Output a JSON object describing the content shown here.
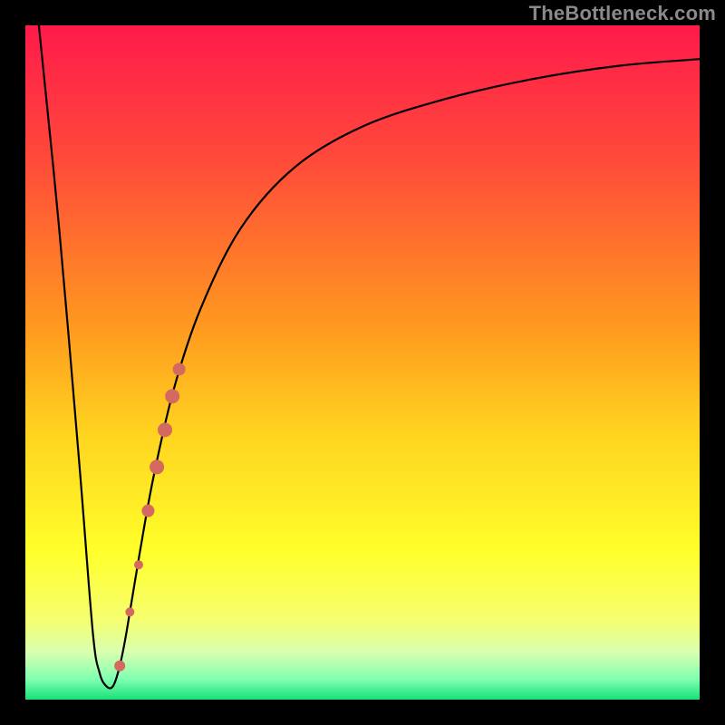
{
  "watermark": {
    "text": "TheBottleneck.com"
  },
  "chart_data": {
    "type": "line",
    "title": "",
    "xlabel": "",
    "ylabel": "",
    "xlim": [
      0,
      100
    ],
    "ylim": [
      0,
      100
    ],
    "grid": false,
    "legend": false,
    "background_gradient_stops": [
      {
        "pct": 0,
        "color": "#ff1a4b"
      },
      {
        "pct": 20,
        "color": "#ff4a3a"
      },
      {
        "pct": 45,
        "color": "#ff9a1f"
      },
      {
        "pct": 60,
        "color": "#ffd21f"
      },
      {
        "pct": 78,
        "color": "#ffff2a"
      },
      {
        "pct": 88,
        "color": "#f6ff6e"
      },
      {
        "pct": 93,
        "color": "#d9ffb0"
      },
      {
        "pct": 97,
        "color": "#7fffb0"
      },
      {
        "pct": 100,
        "color": "#18e078"
      }
    ],
    "series": [
      {
        "name": "bottleneck-curve",
        "stroke": "#000000",
        "stroke_width": 2.2,
        "x": [
          2,
          5,
          8,
          10,
          11,
          12,
          13,
          14,
          15,
          17,
          19,
          22,
          26,
          32,
          40,
          50,
          62,
          75,
          88,
          100
        ],
        "y": [
          100,
          70,
          35,
          10,
          4,
          2,
          2,
          5,
          10,
          22,
          33,
          46,
          58,
          70,
          79,
          85,
          89,
          92,
          94,
          95
        ]
      }
    ],
    "markers": [
      {
        "name": "marker-dot",
        "x": 14.0,
        "y": 5.0,
        "r": 6,
        "color": "#d46a5f"
      },
      {
        "name": "marker-dot",
        "x": 15.5,
        "y": 13.0,
        "r": 5,
        "color": "#d46a5f"
      },
      {
        "name": "marker-dot",
        "x": 16.8,
        "y": 20.0,
        "r": 5,
        "color": "#d46a5f"
      },
      {
        "name": "marker-dot",
        "x": 18.2,
        "y": 28.0,
        "r": 7,
        "color": "#d46a5f"
      },
      {
        "name": "marker-dot",
        "x": 19.5,
        "y": 34.5,
        "r": 8,
        "color": "#d46a5f"
      },
      {
        "name": "marker-dot",
        "x": 20.7,
        "y": 40.0,
        "r": 8,
        "color": "#d46a5f"
      },
      {
        "name": "marker-dot",
        "x": 21.8,
        "y": 45.0,
        "r": 8,
        "color": "#d46a5f"
      },
      {
        "name": "marker-dot",
        "x": 22.8,
        "y": 49.0,
        "r": 7,
        "color": "#d46a5f"
      }
    ]
  }
}
